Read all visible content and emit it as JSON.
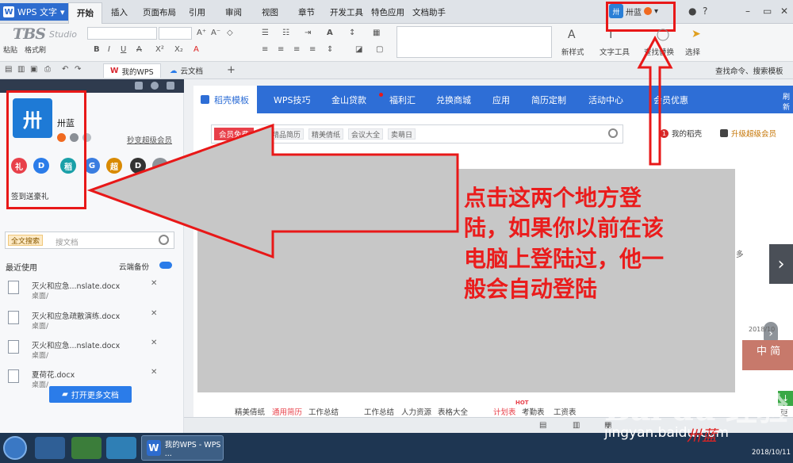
{
  "titlebar": {
    "app_menu": "WPS 文字",
    "tabs": [
      "开始",
      "插入",
      "页面布局",
      "引用",
      "审阅",
      "视图",
      "章节",
      "开发工具",
      "特色应用",
      "文档助手"
    ],
    "user_name": "卅蓝",
    "window_controls": [
      "?",
      "–",
      "▭",
      "✕"
    ]
  },
  "toolbar": {
    "logo_big": "TBS",
    "logo_small": "Studio",
    "clipboard_labels": [
      "粘贴",
      "格式刷"
    ],
    "format_glyphs": [
      "B",
      "I",
      "U",
      "A",
      "X²",
      "X₂",
      "A"
    ],
    "font_size_glyphs": [
      "A⁺",
      "A⁻",
      "◇"
    ],
    "new_style": "新样式",
    "text_tools": "文字工具",
    "find_replace": "查找替换",
    "select": "选择"
  },
  "quickbar": {
    "tabs": [
      {
        "label": "我的WPS",
        "icon": "wps-home-icon"
      },
      {
        "label": "云文档",
        "icon": "cloud-doc-icon"
      }
    ],
    "add_tab": "+",
    "find_command": "查找命令、搜索模板"
  },
  "sidebar": {
    "user_name": "卅蓝",
    "vip_link": "秒变超级会员",
    "app_circles": [
      {
        "glyph": "礼",
        "color": "#e8404a"
      },
      {
        "glyph": "D",
        "color": "#2b7ce9"
      },
      {
        "glyph": "稻",
        "color": "#1aa0a8"
      },
      {
        "glyph": "G",
        "color": "#3a7de0"
      },
      {
        "glyph": "超",
        "color": "#d98a00"
      },
      {
        "glyph": "D",
        "color": "#333333"
      },
      {
        "glyph": "",
        "color": "#8d9399"
      }
    ],
    "signin_gift": "签到送豪礼",
    "signin_button": "签到",
    "search_scope": "全文搜索",
    "search_placeholder": "搜文档",
    "recent_label": "最近使用",
    "cloud_backup": "云端备份",
    "files": [
      {
        "name": "灭火和应急...nslate.docx",
        "path": "桌面/"
      },
      {
        "name": "灭火和应急疏散演练.docx",
        "path": "桌面/"
      },
      {
        "name": "灭火和应急...nslate.docx",
        "path": "桌面/"
      },
      {
        "name": "夏荷花.docx",
        "path": "桌面/"
      }
    ],
    "open_more": "打开更多文档"
  },
  "main": {
    "nav": [
      "稻壳模板",
      "WPS技巧",
      "金山贷款",
      "福利汇",
      "兑换商城",
      "应用",
      "简历定制",
      "活动中心",
      "会员优惠"
    ],
    "refresh": "刷新",
    "vip_free": "会员免费",
    "tags": [
      "精品简历",
      "精美倩纸",
      "会议大全",
      "卖萌日"
    ],
    "my_shell": "我的稻壳",
    "my_shell_count": "1",
    "upgrade_vip": "升级超级会员",
    "ghost_more": "多",
    "banner_date": "2018/10",
    "banner_mid": "中 简",
    "categories": [
      "精美倩纸",
      "通用简历",
      "工作总结",
      "工作总结",
      "人力资源",
      "表格大全",
      "计划表",
      "考勤表",
      "工资表"
    ],
    "hot_badge": "HOT",
    "more": "更"
  },
  "annotation": {
    "lines": [
      "点击这两个地方登",
      "陆，如果你以前在该",
      "电脑上登陆过，他一",
      "般会自动登陆"
    ],
    "color": "#ea1c1c"
  },
  "taskbar": {
    "wps_button": "我的WPS - WPS ...",
    "date": "2018/10/11"
  },
  "watermark": {
    "baidu": "Bai du 经验",
    "site": "jingyan.baidu.com",
    "signature": "卅蓝"
  }
}
